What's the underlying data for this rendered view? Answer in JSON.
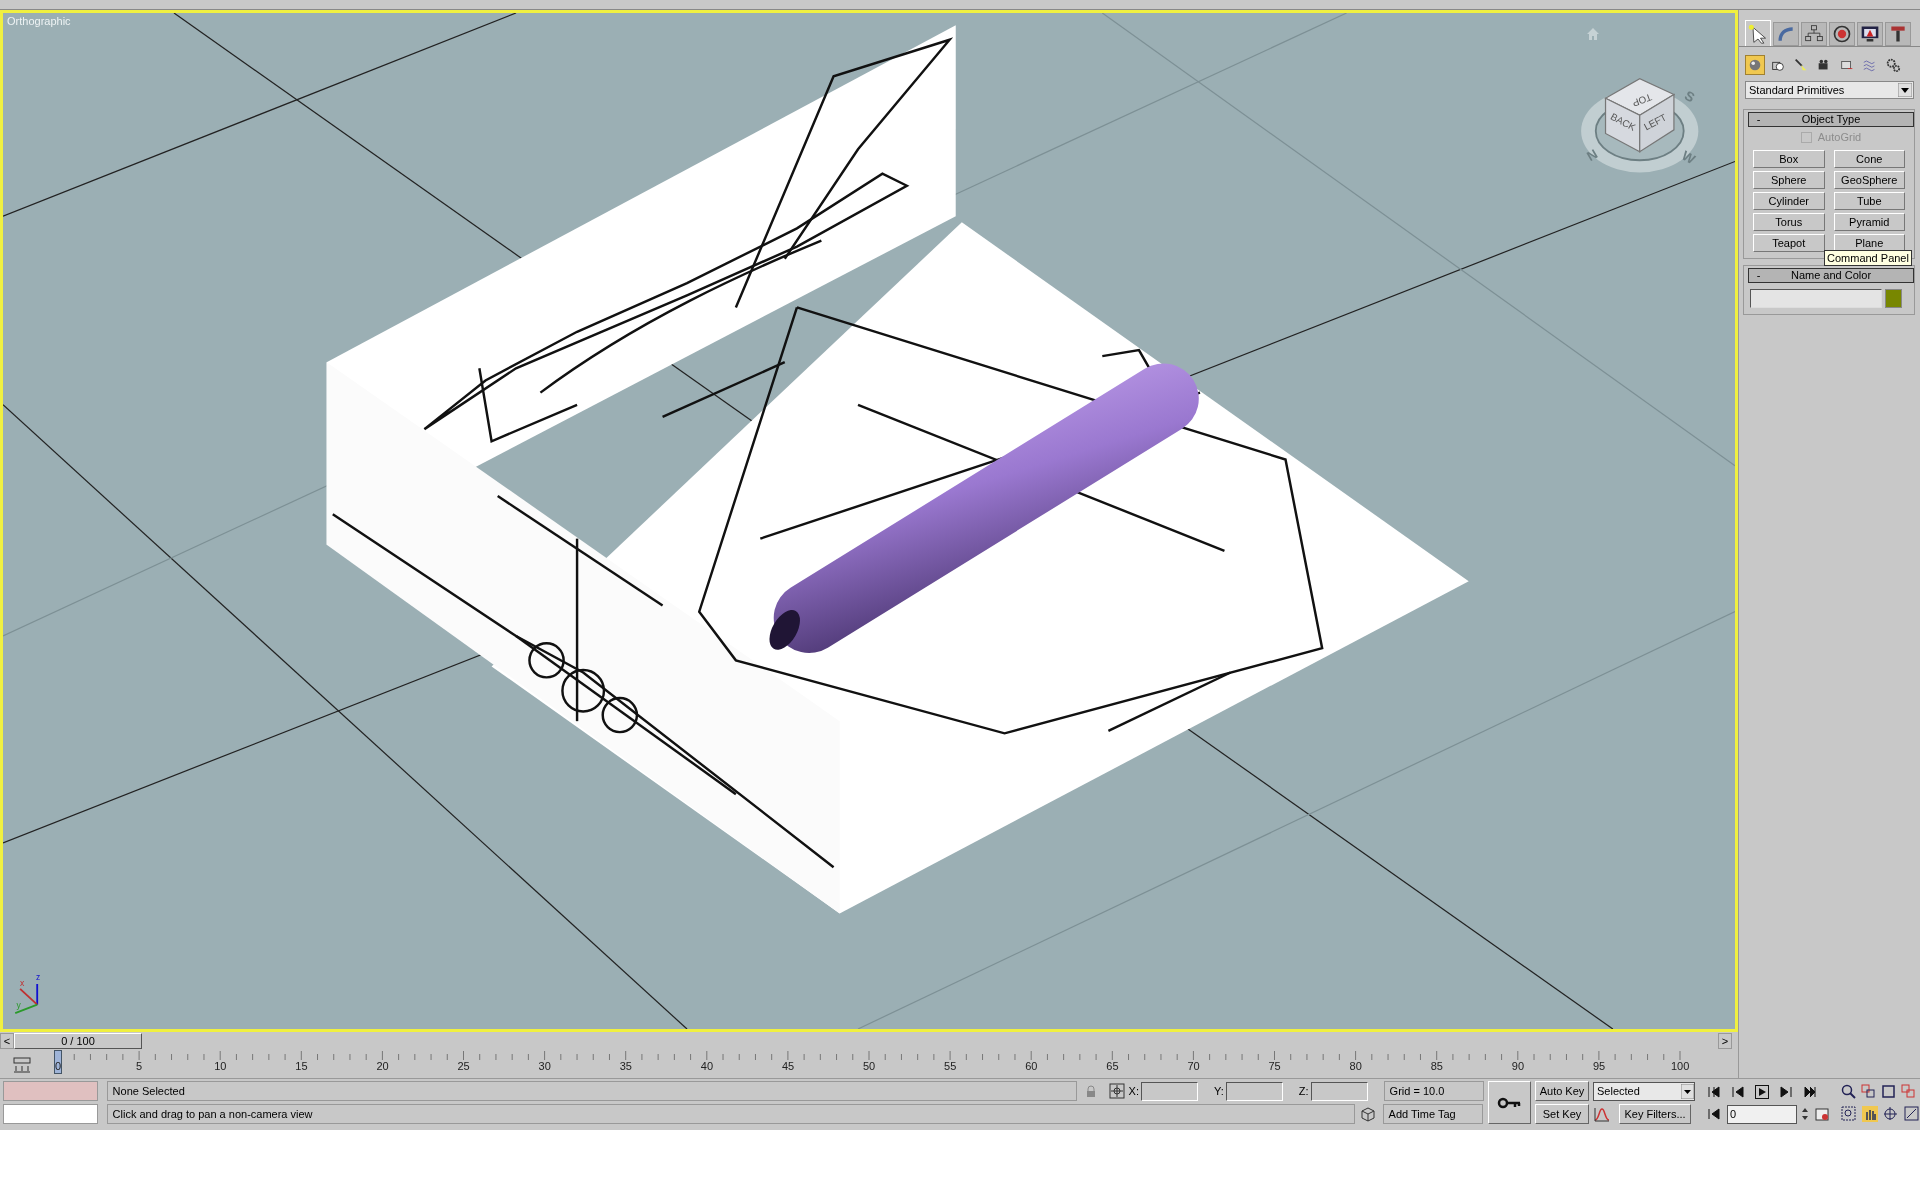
{
  "viewport": {
    "label": "Orthographic",
    "active": true,
    "viewcube": {
      "faces": [
        "TOP",
        "BACK",
        "LEFT"
      ],
      "compass": [
        "N",
        "W",
        "S"
      ]
    },
    "axis_labels": [
      "z",
      "x",
      "y"
    ]
  },
  "command_panel": {
    "tabs": [
      {
        "kind": "create",
        "selected": true
      },
      {
        "kind": "modify",
        "selected": false
      },
      {
        "kind": "hierarchy",
        "selected": false
      },
      {
        "kind": "motion",
        "selected": false
      },
      {
        "kind": "display",
        "selected": false
      },
      {
        "kind": "utilities",
        "selected": false
      }
    ],
    "categories": [
      {
        "kind": "geometry",
        "selected": true
      },
      {
        "kind": "shapes",
        "selected": false
      },
      {
        "kind": "lights",
        "selected": false
      },
      {
        "kind": "cameras",
        "selected": false
      },
      {
        "kind": "helpers",
        "selected": false
      },
      {
        "kind": "spacewarps",
        "selected": false
      },
      {
        "kind": "systems",
        "selected": false
      }
    ],
    "dropdown": "Standard Primitives",
    "object_type": {
      "toggle": "-",
      "title": "Object Type",
      "autogrid": {
        "label": "AutoGrid",
        "checked": false,
        "disabled": true
      },
      "buttons": [
        "Box",
        "Cone",
        "Sphere",
        "GeoSphere",
        "Cylinder",
        "Tube",
        "Torus",
        "Pyramid",
        "Teapot",
        "Plane"
      ]
    },
    "name_and_color": {
      "toggle": "-",
      "title": "Name and Color",
      "color": "#788700"
    },
    "tooltip": "Command Panel"
  },
  "time_slider": {
    "prev": "<",
    "position": "0 / 100",
    "next": ">",
    "level": 0
  },
  "track_bar": {
    "ticks": [
      "0",
      "5",
      "10",
      "15",
      "20",
      "25",
      "30",
      "35",
      "40",
      "45",
      "50",
      "55",
      "60",
      "65",
      "70",
      "75",
      "80",
      "85",
      "90",
      "95",
      "100"
    ]
  },
  "status": {
    "selection": "None Selected",
    "prompt": "Click and drag to pan a non-camera view",
    "x_label": "X:",
    "y_label": "Y:",
    "z_label": "Z:",
    "grid": "Grid = 10.0",
    "time_tag": "Add Time Tag",
    "auto_key": {
      "label": "Auto Key",
      "on": false
    },
    "key_mode": "Selected",
    "set_key": "Set Key",
    "key_filters": "Key Filters...",
    "frame": "0"
  }
}
